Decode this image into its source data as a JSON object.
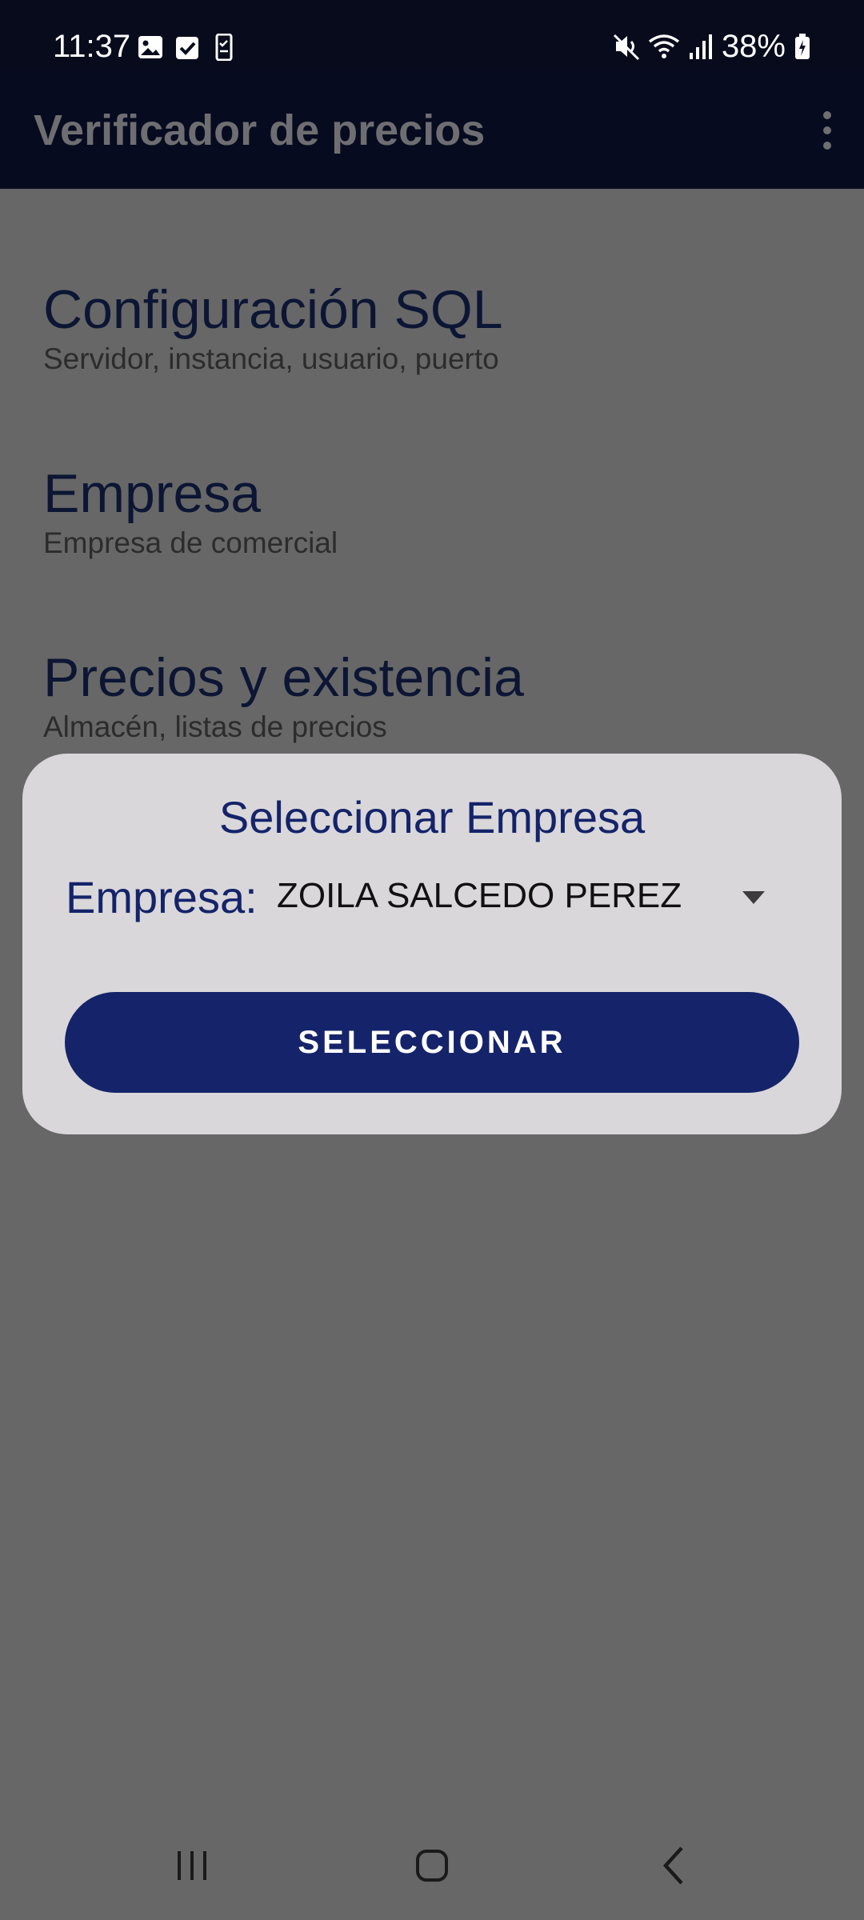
{
  "status_bar": {
    "time": "11:37",
    "left_icons": [
      "gallery-icon",
      "check-box-icon",
      "phone-task-icon"
    ],
    "right_icons": [
      "mute-icon",
      "wifi-icon",
      "signal-icon",
      "battery-charging-icon"
    ],
    "battery": "38%"
  },
  "app_bar": {
    "title": "Verificador de precios",
    "menu_icon": "more-vert-icon"
  },
  "preferences": [
    {
      "title": "Configuración SQL",
      "summary": "Servidor, instancia, usuario, puerto"
    },
    {
      "title": "Empresa",
      "summary": "Empresa de comercial"
    },
    {
      "title": "Precios y existencia",
      "summary": "Almacén, listas de precios"
    }
  ],
  "dialog": {
    "title": "Seleccionar Empresa",
    "field_label": "Empresa:",
    "selected_value": "ZOILA SALCEDO PEREZ",
    "button_label": "SELECCIONAR"
  },
  "nav_bar": {
    "buttons": [
      "recents-icon",
      "home-icon",
      "back-icon"
    ]
  },
  "colors": {
    "scrim": "#676767",
    "app_bar": "#060b1f",
    "dialog_bg": "#d9d7d9",
    "accent": "#15246a"
  }
}
